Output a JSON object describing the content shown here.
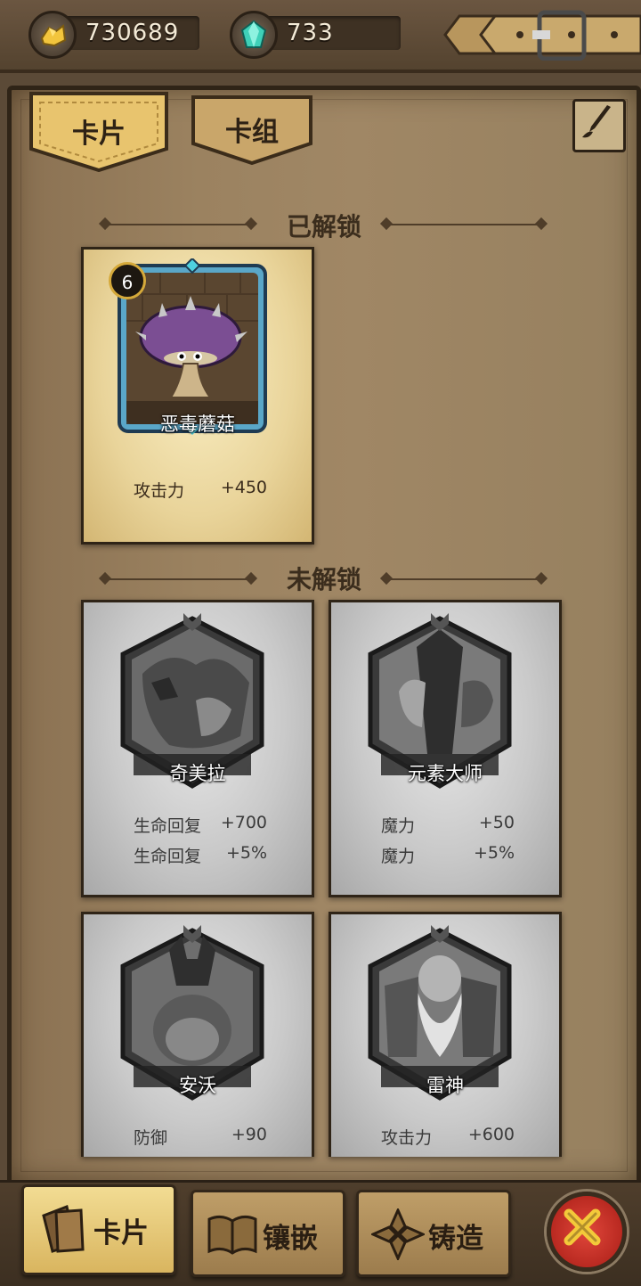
{
  "resources": {
    "gold": {
      "icon": "gold-nugget-icon",
      "value": "730689"
    },
    "gems": {
      "icon": "gem-icon",
      "value": "733"
    }
  },
  "tabs": [
    {
      "label": "卡片",
      "active": true
    },
    {
      "label": "卡组",
      "active": false
    }
  ],
  "sections": {
    "unlocked": "已解锁",
    "locked": "未解锁"
  },
  "unlocked_cards": [
    {
      "name": "恶毒蘑菇",
      "level": "6",
      "stats": [
        {
          "k": "攻击力",
          "v": "+450"
        }
      ]
    }
  ],
  "locked_cards": [
    {
      "name": "奇美拉",
      "stats": [
        {
          "k": "生命回复",
          "v": "+700"
        },
        {
          "k": "生命回复",
          "v": "+5%"
        }
      ]
    },
    {
      "name": "元素大师",
      "stats": [
        {
          "k": "魔力",
          "v": "+50"
        },
        {
          "k": "魔力",
          "v": "+5%"
        }
      ]
    },
    {
      "name": "安沃",
      "stats": [
        {
          "k": "防御",
          "v": "+90"
        }
      ]
    },
    {
      "name": "雷神",
      "stats": [
        {
          "k": "攻击力",
          "v": "+600"
        }
      ]
    }
  ],
  "bottom_nav": [
    {
      "label": "卡片",
      "icon": "cards-icon",
      "active": true
    },
    {
      "label": "镶嵌",
      "icon": "book-icon",
      "active": false
    },
    {
      "label": "铸造",
      "icon": "forge-icon",
      "active": false
    }
  ],
  "colors": {
    "wood": "#9b8260",
    "gold_tab": "#e8c46e",
    "close_red": "#d1342a",
    "gem": "#3fd0b8"
  }
}
